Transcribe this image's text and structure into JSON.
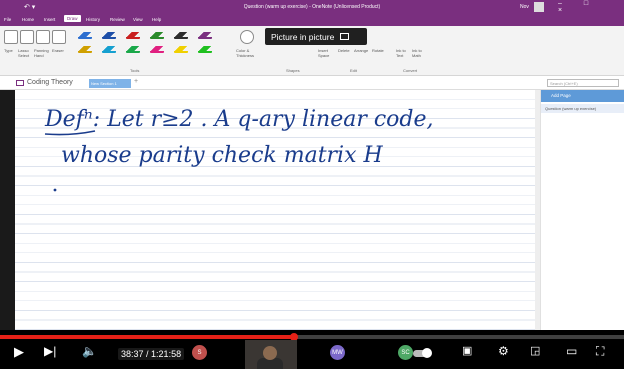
{
  "window": {
    "title": "Question (warm up exercise) - OneNote (Unlicensed Product)",
    "user": "Nov",
    "quick_access": "↶ ▾",
    "controls": "–  □  ×"
  },
  "menu": {
    "items": [
      "File",
      "Home",
      "Insert",
      "Draw",
      "History",
      "Review",
      "View",
      "Help"
    ],
    "active": "Draw"
  },
  "ribbon": {
    "tools": [
      "Type",
      "Lasso Select",
      "Panning Hand",
      "Eraser"
    ],
    "color_thickness": "Color & Thickness",
    "insert_space": "Insert Space",
    "edit_tools": [
      "Delete",
      "Arrange",
      "Rotate"
    ],
    "convert": [
      "Ink to Text",
      "Ink to Math"
    ],
    "groups": [
      "Tools",
      "Shapes",
      "Edit",
      "Convert"
    ],
    "pen_colors": [
      "#2d6fd0",
      "#1e4fa8",
      "#c92020",
      "#2a8a2a",
      "#2d2d2d",
      "#7a2f7f",
      "#d0a000",
      "#16a0d0",
      "#1aa84a",
      "#e02080",
      "#f0d000",
      "#20c020"
    ]
  },
  "pip": {
    "label": "Picture in picture"
  },
  "notebook": {
    "name": "Coding Theory",
    "section_tab": "New Section 1",
    "add_tab": "+",
    "search_placeholder": "Search (Ctrl+E)"
  },
  "page": {
    "handwriting_line1": "Defⁿ: Let r≥2 . A q-ary linear code,",
    "handwriting_line2": "whose parity check matrix  H",
    "ink_color": "#1a3c8c"
  },
  "pages_panel": {
    "add_page": "Add Page",
    "items": [
      "Question (warm up exercise)"
    ]
  },
  "player": {
    "elapsed": "38:37",
    "duration": "1:21:58",
    "progress": 0.471,
    "accent": "#e62117",
    "participants": [
      {
        "initials": "S",
        "color": "#c0504d"
      },
      {
        "initials": "MW",
        "color": "#7b68c9"
      },
      {
        "initials": "SC",
        "color": "#4ea866"
      }
    ]
  }
}
